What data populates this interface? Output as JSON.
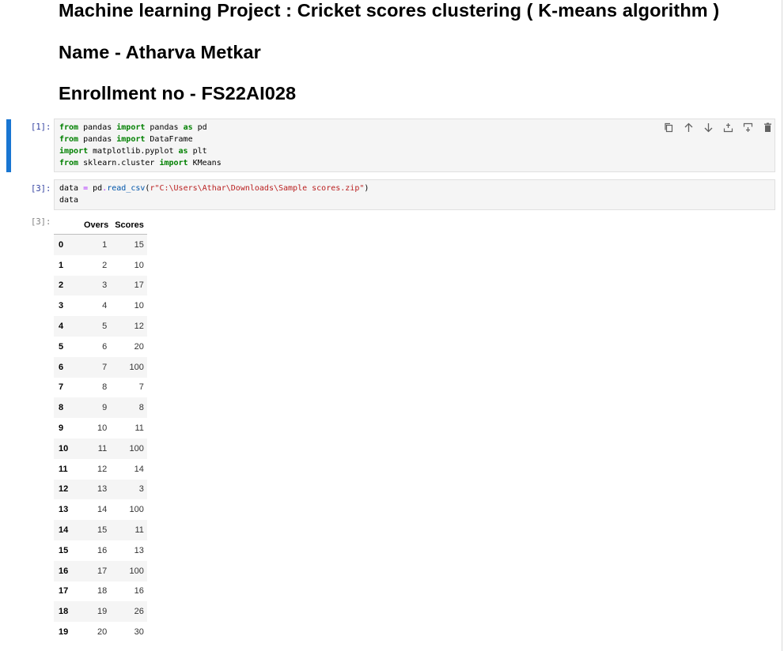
{
  "markdown": {
    "title": "Machine learning Project : Cricket scores clustering ( K-means algorithm )",
    "name": "Name - Atharva Metkar",
    "enrollment": "Enrollment no - FS22AI028"
  },
  "cells": {
    "cell1": {
      "prompt": "[1]:"
    },
    "cell2": {
      "prompt": "[3]:"
    },
    "output2": {
      "prompt": "[3]:"
    }
  },
  "toolbar": {
    "icons": [
      "copy-icon",
      "arrow-up-icon",
      "arrow-down-icon",
      "insert-above-icon",
      "insert-below-icon",
      "delete-icon"
    ]
  },
  "dataframe": {
    "columns": [
      "",
      "Overs",
      "Scores"
    ],
    "rows": [
      [
        "0",
        "1",
        "15"
      ],
      [
        "1",
        "2",
        "10"
      ],
      [
        "2",
        "3",
        "17"
      ],
      [
        "3",
        "4",
        "10"
      ],
      [
        "4",
        "5",
        "12"
      ],
      [
        "5",
        "6",
        "20"
      ],
      [
        "6",
        "7",
        "100"
      ],
      [
        "7",
        "8",
        "7"
      ],
      [
        "8",
        "9",
        "8"
      ],
      [
        "9",
        "10",
        "11"
      ],
      [
        "10",
        "11",
        "100"
      ],
      [
        "11",
        "12",
        "14"
      ],
      [
        "12",
        "13",
        "3"
      ],
      [
        "13",
        "14",
        "100"
      ],
      [
        "14",
        "15",
        "11"
      ],
      [
        "15",
        "16",
        "13"
      ],
      [
        "16",
        "17",
        "100"
      ],
      [
        "17",
        "18",
        "16"
      ],
      [
        "18",
        "19",
        "26"
      ],
      [
        "19",
        "20",
        "30"
      ]
    ]
  }
}
